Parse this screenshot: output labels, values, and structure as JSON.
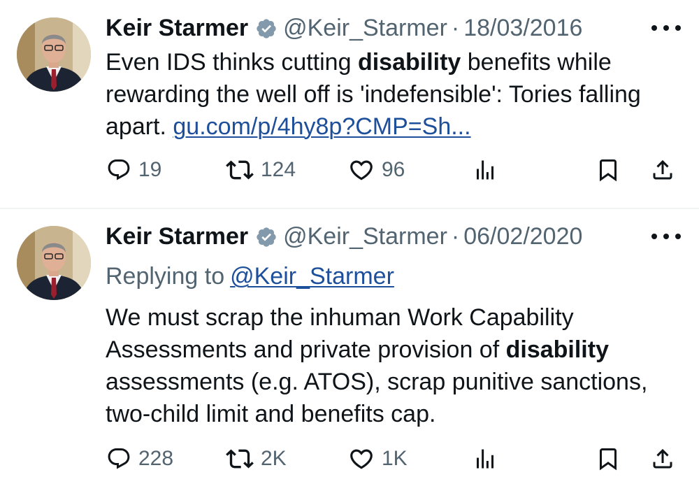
{
  "tweets": [
    {
      "author_name": "Keir Starmer",
      "handle": "@Keir_Starmer",
      "separator": "·",
      "date": "18/03/2016",
      "text_before_bold": "Even IDS thinks cutting ",
      "bold": "disability",
      "text_after_bold": " benefits while rewarding the well off is 'indefensible': Tories falling apart.  ",
      "link": "gu.com/p/4hy8p?CMP=Sh...",
      "replies": "19",
      "retweets": "124",
      "likes": "96"
    },
    {
      "author_name": "Keir Starmer",
      "handle": "@Keir_Starmer",
      "separator": "·",
      "date": "06/02/2020",
      "replying_to_label": "Replying to",
      "replying_to_handle": "@Keir_Starmer",
      "text_before_bold": "We must scrap the inhuman Work Capability Assessments and private provision of ",
      "bold": "disability",
      "text_after_bold": " assessments (e.g. ATOS), scrap punitive sanctions, two-child limit and benefits cap.",
      "replies": "228",
      "retweets": "2K",
      "likes": "1K"
    }
  ],
  "icons": [
    "verified-badge-icon",
    "more-options-icon",
    "reply-icon",
    "retweet-icon",
    "like-icon",
    "views-icon",
    "bookmark-icon",
    "share-icon"
  ],
  "colors": {
    "text": "#0f1419",
    "secondary": "#536471",
    "link": "#1d4f9a",
    "divider": "#eff3f4",
    "badge": "#829aab"
  }
}
